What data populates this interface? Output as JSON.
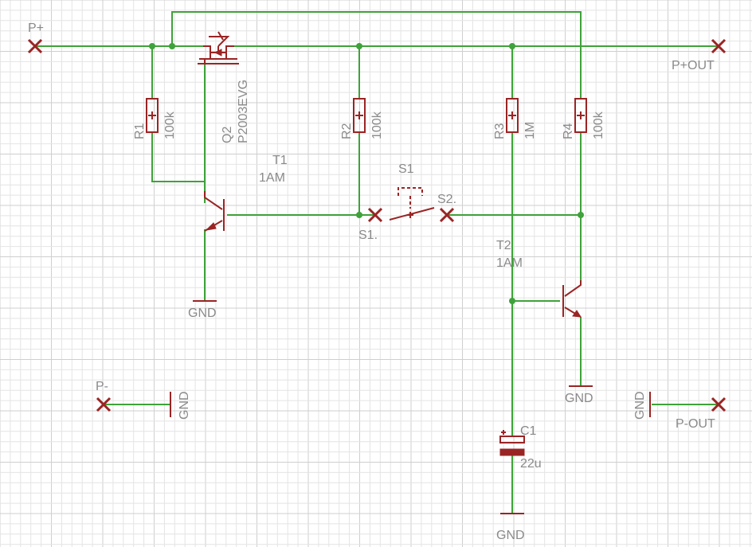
{
  "colors": {
    "wire": "#3fa23a",
    "part": "#9a2424",
    "label": "#8a8a8a",
    "grid": "#e4e4e4",
    "background": "#ffffff"
  },
  "connectors": {
    "p_plus": "P+",
    "p_plus_out": "P+OUT",
    "p_minus": "P-",
    "p_minus_out": "P-OUT"
  },
  "resistors": {
    "r1": {
      "name": "R1",
      "value": "100k"
    },
    "r2": {
      "name": "R2",
      "value": "100k"
    },
    "r3": {
      "name": "R3",
      "value": "1M"
    },
    "r4": {
      "name": "R4",
      "value": "100k"
    }
  },
  "mosfet": {
    "name": "Q2",
    "value": "P2003EVG"
  },
  "transistors": {
    "t1": {
      "name": "T1",
      "value": "1AM"
    },
    "t2": {
      "name": "T2",
      "value": "1AM"
    }
  },
  "switch": {
    "name": "S1",
    "pin1": "S1.",
    "pin2": "S2."
  },
  "capacitor": {
    "name": "C1",
    "value": "22u"
  },
  "ground": "GND"
}
